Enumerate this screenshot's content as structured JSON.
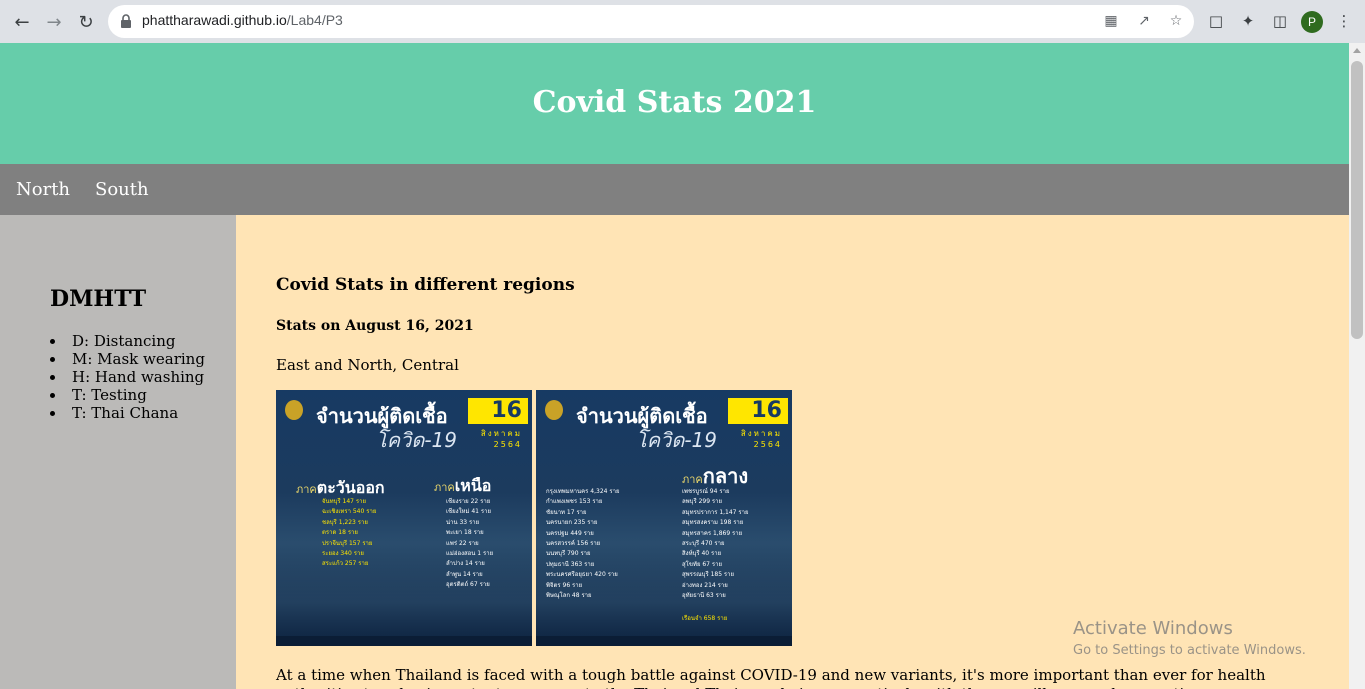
{
  "browser": {
    "url_host": "phattharawadi.github.io",
    "url_path": "/Lab4/P3",
    "profile_initial": "P"
  },
  "header": {
    "title": "Covid Stats 2021"
  },
  "nav": {
    "items": [
      "North",
      "South"
    ]
  },
  "sidebar": {
    "title": "DMHTT",
    "items": [
      "D: Distancing",
      "M: Mask wearing",
      "H: Hand washing",
      "T: Testing",
      "T: Thai Chana"
    ]
  },
  "main": {
    "heading": "Covid Stats in different regions",
    "subheading": "Stats on August 16, 2021",
    "regions_text": "East and North, Central",
    "paragraph": "At a time when Thailand is faced with a tough battle against COVID-19 and new variants, it's more important than ever for health authorities to relay important messages to the Thai and Thai people is cooperatively with the surveillance and preventive measures including Sandwich, Lores and M..."
  },
  "poster_east_north": {
    "title": "จำนวนผู้ติดเชื้อ",
    "day": "16",
    "subtitle": "โควิด-19",
    "month": "สิงหาคม",
    "year": "2564",
    "region_prefix": "ภาค",
    "region_a": "ตะวันออก",
    "region_b": "เหนือ",
    "rows_a": [
      "จันทบุรี 147 ราย",
      "ฉะเชิงเทรา 540 ราย",
      "ชลบุรี 1,223 ราย",
      "ตราด 18 ราย",
      "ปราจีนบุรี 157 ราย",
      "ระยอง 340 ราย",
      "สระแก้ว 257 ราย"
    ],
    "rows_b": [
      "เชียงราย 22 ราย",
      "เชียงใหม่ 41 ราย",
      "น่าน 33 ราย",
      "พะเยา 18 ราย",
      "แพร่ 22 ราย",
      "แม่ฮ่องสอน 1 ราย",
      "ลำปาง 14 ราย",
      "ลำพูน 14 ราย",
      "อุตรดิตถ์ 67 ราย"
    ]
  },
  "poster_central": {
    "title": "จำนวนผู้ติดเชื้อ",
    "day": "16",
    "subtitle": "โควิด-19",
    "month": "สิงหาคม",
    "year": "2564",
    "region_prefix": "ภาค",
    "region": "กลาง",
    "rows_a": [
      "กรุงเทพมหานคร 4,324 ราย",
      "กำแพงเพชร 153 ราย",
      "ชัยนาท 17 ราย",
      "นครนายก 235 ราย",
      "นครปฐม 449 ราย",
      "นครสวรรค์ 156 ราย",
      "นนทบุรี 790 ราย",
      "ปทุมธานี 363 ราย",
      "พระนครศรีอยุธยา 420 ราย",
      "พิจิตร 96 ราย",
      "พิษณุโลก 48 ราย"
    ],
    "rows_b": [
      "เพชรบูรณ์ 94 ราย",
      "ลพบุรี 299 ราย",
      "สมุทรปราการ 1,147 ราย",
      "สมุทรสงคราม 198 ราย",
      "สมุทรสาคร 1,869 ราย",
      "สระบุรี 470 ราย",
      "สิงห์บุรี 40 ราย",
      "สุโขทัย 67 ราย",
      "สุพรรณบุรี 185 ราย",
      "อ่างทอง 214 ราย",
      "อุทัยธานี 63 ราย"
    ],
    "extra": "เรือนจำ 658 ราย"
  },
  "watermark": {
    "line1": "Activate Windows",
    "line2": "Go to Settings to activate Windows."
  }
}
